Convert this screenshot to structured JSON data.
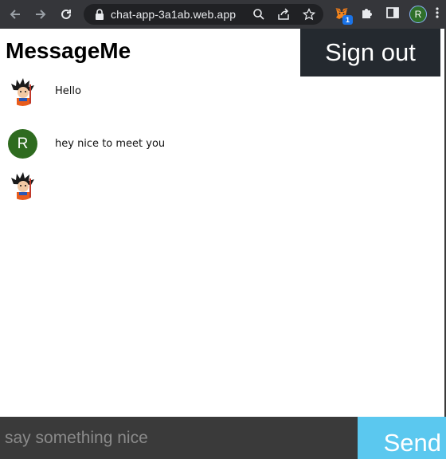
{
  "browser": {
    "url": "chat-app-3a1ab.web.app",
    "extension_badge": "1",
    "profile_initial": "R",
    "icons": [
      "back-arrow-icon",
      "forward-arrow-icon",
      "reload-icon",
      "lock-icon",
      "zoom-icon",
      "share-icon",
      "star-icon",
      "metamask-fox-icon",
      "puzzle-icon",
      "side-panel-icon",
      "kebab-menu-icon"
    ]
  },
  "app": {
    "title": "MessageMe",
    "sign_out_label": "Sign out"
  },
  "messages": [
    {
      "avatar": "goku-avatar",
      "text": "Hello"
    },
    {
      "avatar": "letter-avatar",
      "avatar_letter": "R",
      "text": "hey nice to meet you"
    },
    {
      "avatar": "goku-avatar",
      "text": ""
    }
  ],
  "composer": {
    "placeholder": "say something nice",
    "value": "",
    "send_label": "Send"
  },
  "colors": {
    "chrome": "#35363a",
    "sign_out_bg": "#24292f",
    "composer_bg": "#3a3a3a",
    "send_bg": "#5bc8ef",
    "letter_avatar_bg": "#2e6b1f"
  }
}
